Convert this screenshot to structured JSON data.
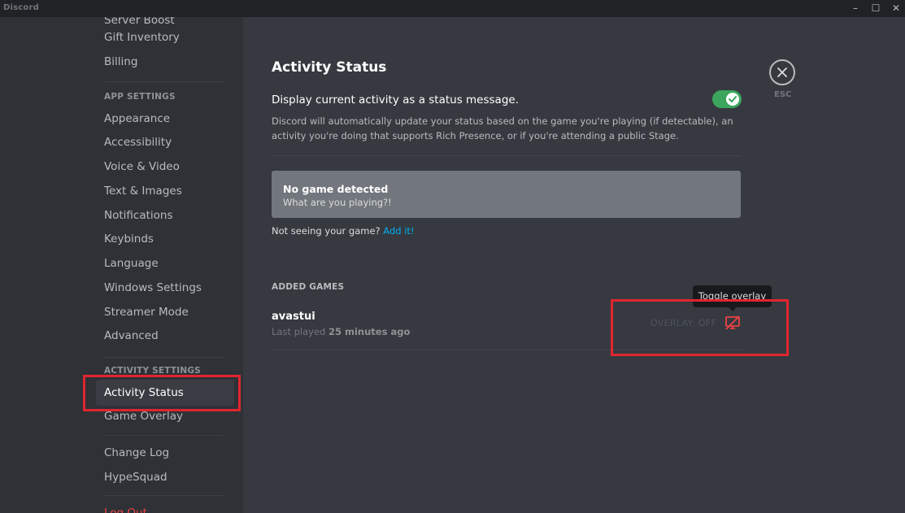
{
  "window": {
    "title": "Discord"
  },
  "sidebar": {
    "items_top": [
      {
        "label": "Server Boost"
      },
      {
        "label": "Gift Inventory"
      },
      {
        "label": "Billing"
      }
    ],
    "app_settings_header": "APP SETTINGS",
    "app_settings": [
      {
        "label": "Appearance"
      },
      {
        "label": "Accessibility"
      },
      {
        "label": "Voice & Video"
      },
      {
        "label": "Text & Images"
      },
      {
        "label": "Notifications"
      },
      {
        "label": "Keybinds"
      },
      {
        "label": "Language"
      },
      {
        "label": "Windows Settings"
      },
      {
        "label": "Streamer Mode"
      },
      {
        "label": "Advanced"
      }
    ],
    "activity_settings_header": "ACTIVITY SETTINGS",
    "activity_settings": [
      {
        "label": "Activity Status",
        "selected": true
      },
      {
        "label": "Game Overlay"
      }
    ],
    "misc": [
      {
        "label": "Change Log"
      },
      {
        "label": "HypeSquad"
      }
    ],
    "logout_label": "Log Out"
  },
  "main": {
    "title": "Activity Status",
    "display_activity": {
      "label": "Display current activity as a status message.",
      "description": "Discord will automatically update your status based on the game you're playing (if detectable), an activity you're doing that supports Rich Presence, or if you're attending a public Stage.",
      "enabled": true
    },
    "no_game": {
      "title": "No game detected",
      "subtitle": "What are you playing?!"
    },
    "not_seeing": {
      "text": "Not seeing your game?",
      "link": "Add it!"
    },
    "added_games_header": "ADDED GAMES",
    "games": [
      {
        "name": "avastui",
        "last_played_prefix": "Last played",
        "last_played_value": "25 minutes ago",
        "overlay_status": "OVERLAY: OFF"
      }
    ],
    "tooltip": "Toggle overlay",
    "close_label": "ESC"
  },
  "colors": {
    "accent_green": "#3ba55d",
    "link_blue": "#00aff4",
    "annotation_red": "#e1252f",
    "danger_red": "#ed4245"
  },
  "icons": [
    "close-icon",
    "check-icon",
    "overlay-off-icon",
    "minimize-icon",
    "maximize-icon"
  ]
}
